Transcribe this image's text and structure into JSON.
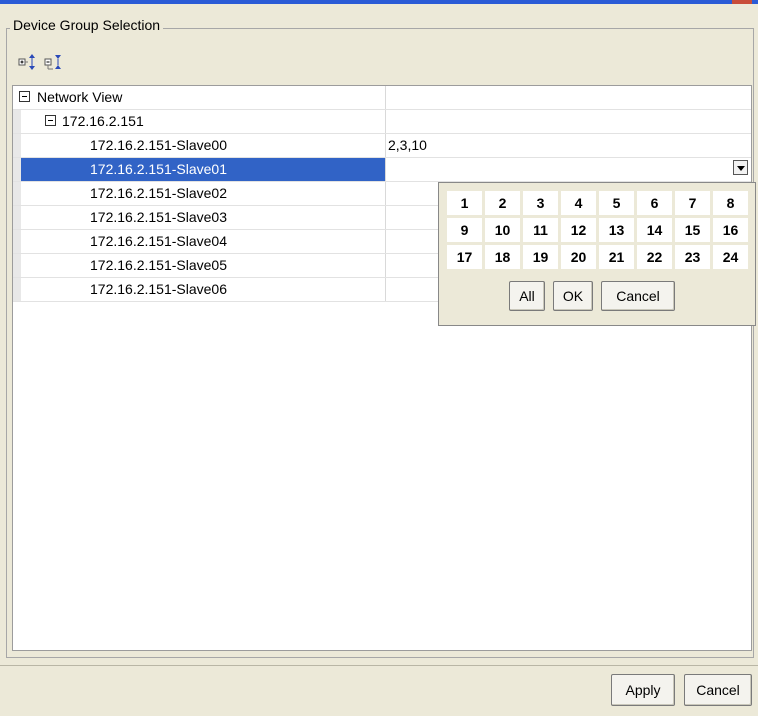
{
  "group_title": "Device Group Selection",
  "toolbar": {
    "expand_icon": "expand-all-icon",
    "collapse_icon": "collapse-all-icon"
  },
  "tree": {
    "root": {
      "label": "Network View",
      "value": ""
    },
    "host": {
      "label": "172.16.2.151",
      "value": ""
    },
    "rows": [
      {
        "label": "172.16.2.151-Slave00",
        "value": "2,3,10",
        "selected": false
      },
      {
        "label": "172.16.2.151-Slave01",
        "value": "",
        "selected": true
      },
      {
        "label": "172.16.2.151-Slave02",
        "value": "",
        "selected": false
      },
      {
        "label": "172.16.2.151-Slave03",
        "value": "",
        "selected": false
      },
      {
        "label": "172.16.2.151-Slave04",
        "value": "",
        "selected": false
      },
      {
        "label": "172.16.2.151-Slave05",
        "value": "",
        "selected": false
      },
      {
        "label": "172.16.2.151-Slave06",
        "value": "",
        "selected": false
      }
    ]
  },
  "popup": {
    "numbers": [
      "1",
      "2",
      "3",
      "4",
      "5",
      "6",
      "7",
      "8",
      "9",
      "10",
      "11",
      "12",
      "13",
      "14",
      "15",
      "16",
      "17",
      "18",
      "19",
      "20",
      "21",
      "22",
      "23",
      "24"
    ],
    "all_label": "All",
    "ok_label": "OK",
    "cancel_label": "Cancel"
  },
  "footer": {
    "apply_label": "Apply",
    "cancel_label": "Cancel"
  },
  "colors": {
    "selection": "#3163c6",
    "title_bar": "#2a5bd6",
    "window_bg": "#ece9d8"
  }
}
